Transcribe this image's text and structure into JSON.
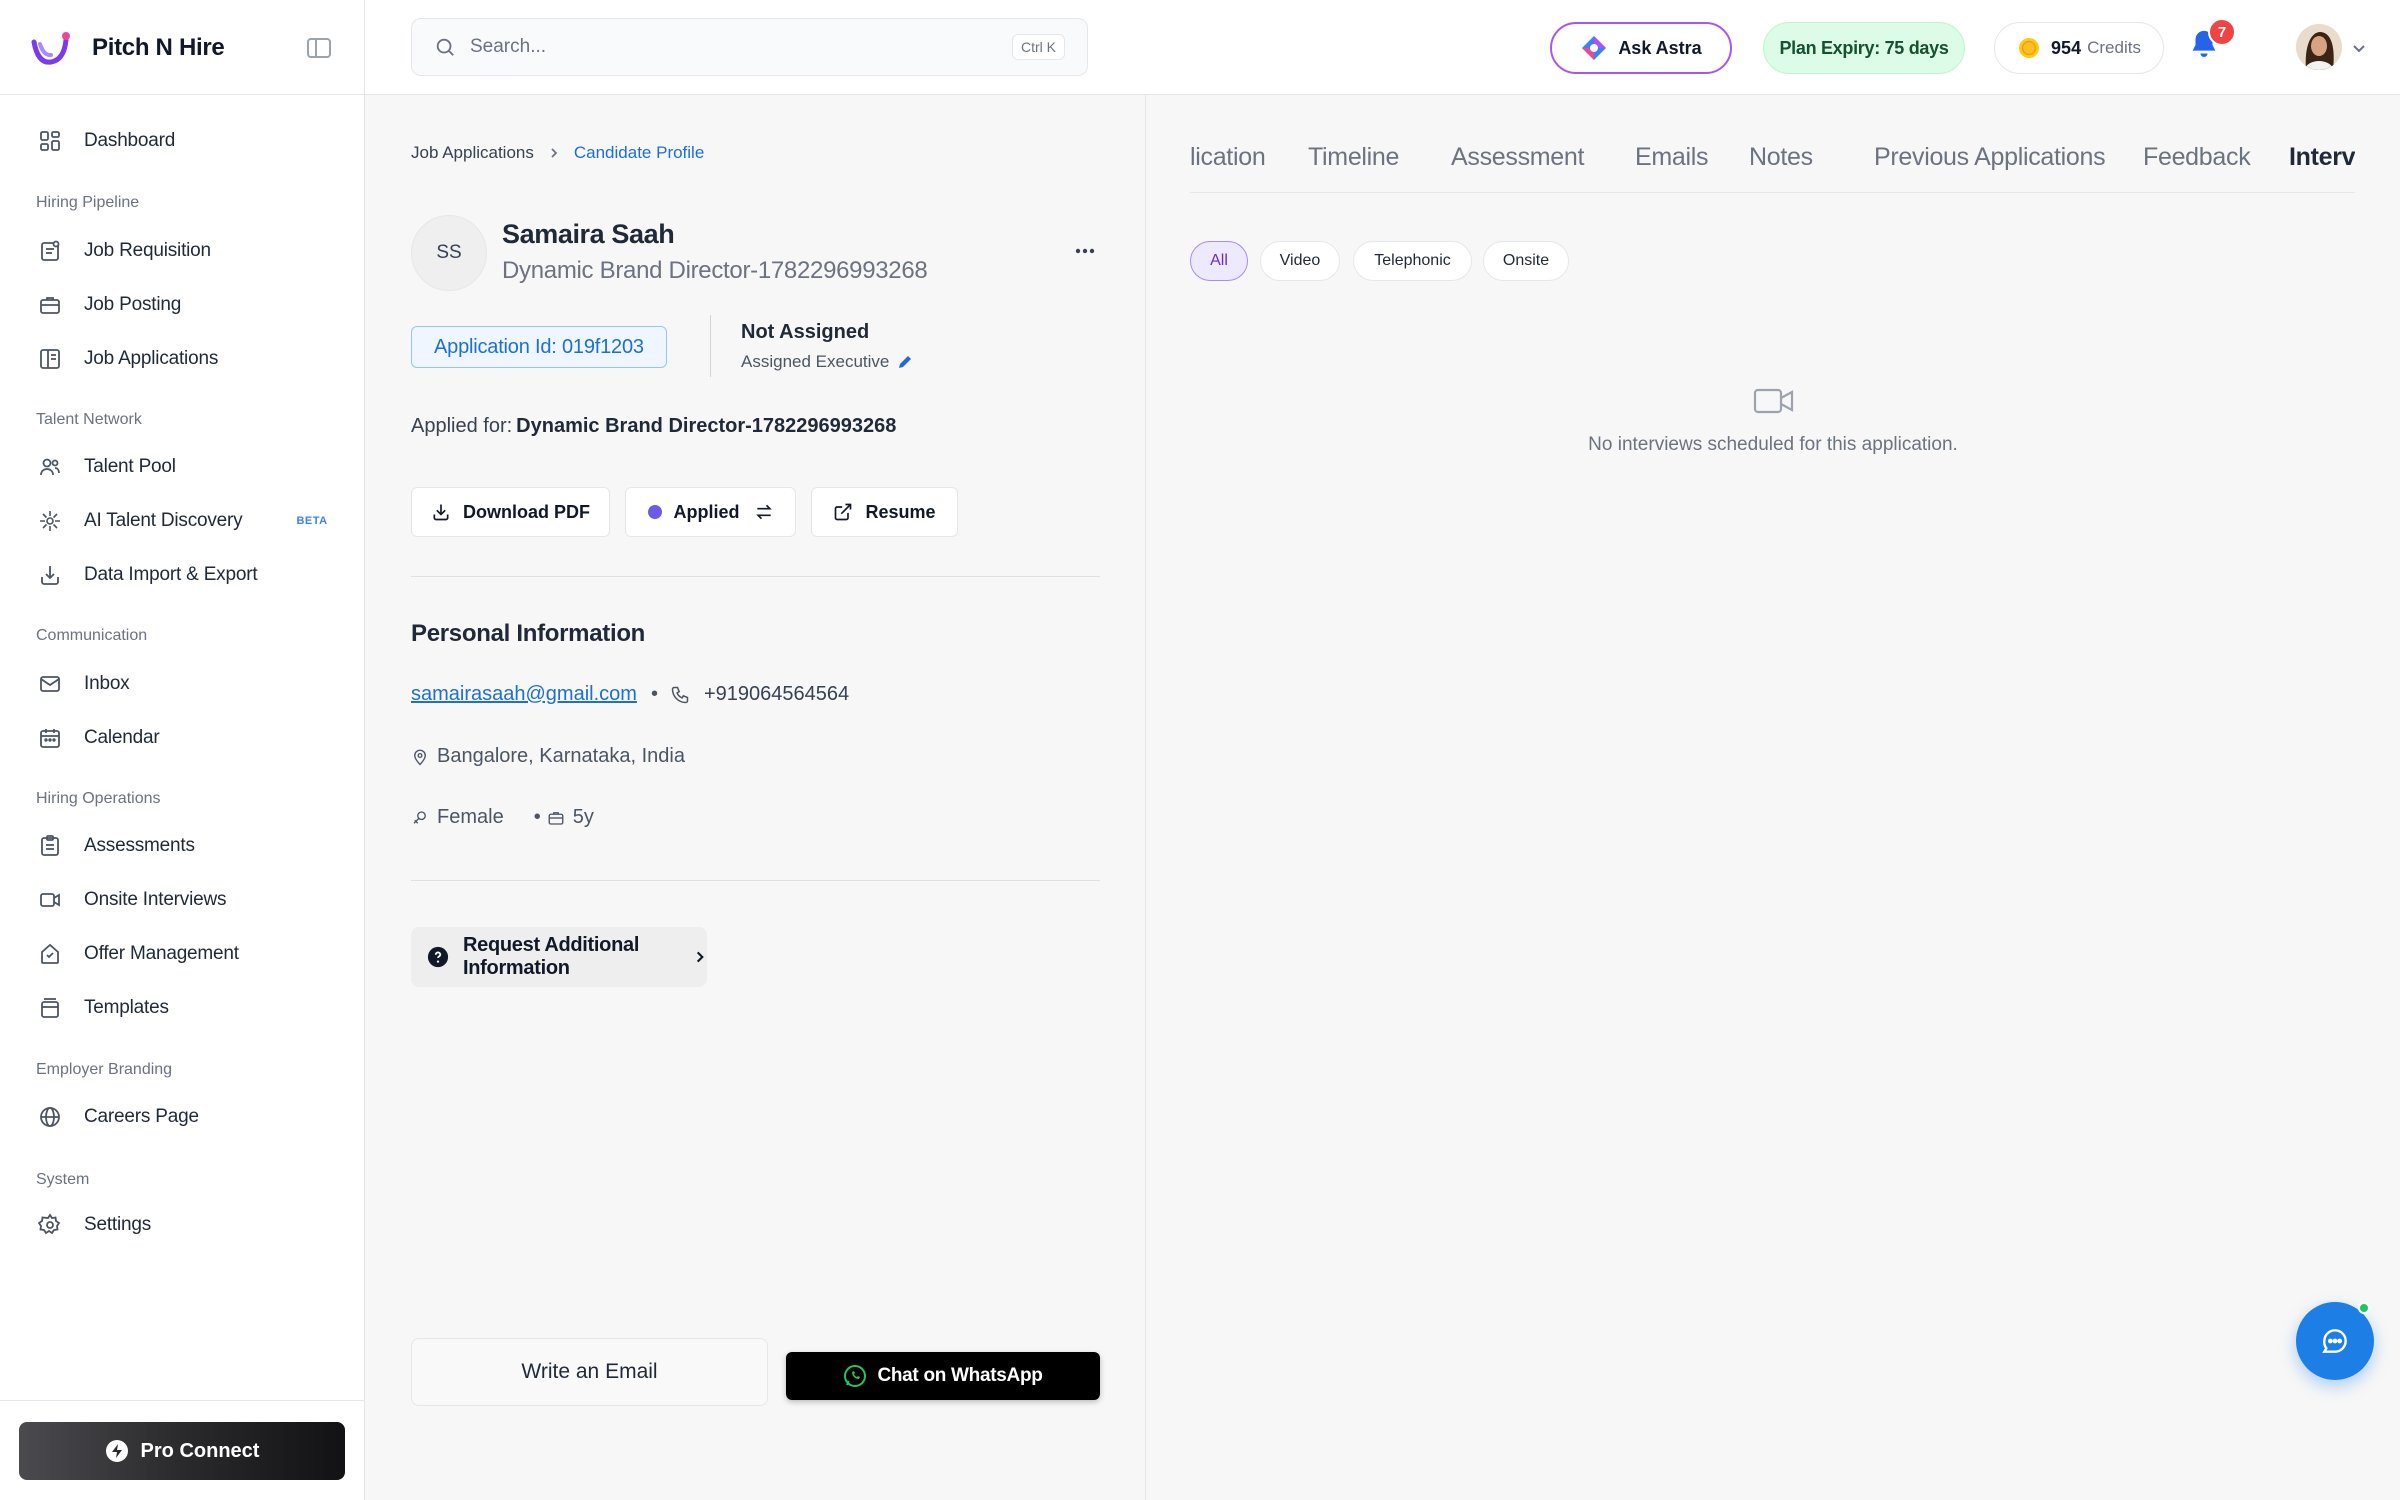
{
  "brand": {
    "name": "Pitch N Hire"
  },
  "sidebar": {
    "items": [
      {
        "label": "Dashboard",
        "icon": "dashboard-grid-icon"
      },
      {
        "section": "Hiring Pipeline"
      },
      {
        "label": "Job Requisition",
        "icon": "clipboard-icon"
      },
      {
        "label": "Job Posting",
        "icon": "briefcase-icon"
      },
      {
        "label": "Job Applications",
        "icon": "applications-icon"
      },
      {
        "section": "Talent Network"
      },
      {
        "label": "Talent Pool",
        "icon": "users-icon"
      },
      {
        "label": "AI Talent Discovery",
        "icon": "ai-spark-icon",
        "badge": "BETA"
      },
      {
        "label": "Data Import & Export",
        "icon": "import-icon"
      },
      {
        "section": "Communication"
      },
      {
        "label": "Inbox",
        "icon": "mail-icon"
      },
      {
        "label": "Calendar",
        "icon": "calendar-icon"
      },
      {
        "section": "Hiring Operations"
      },
      {
        "label": "Assessments",
        "icon": "assessment-icon"
      },
      {
        "label": "Onsite Interviews",
        "icon": "video-icon"
      },
      {
        "label": "Offer Management",
        "icon": "offer-icon"
      },
      {
        "label": "Templates",
        "icon": "templates-icon"
      },
      {
        "section": "Employer Branding"
      },
      {
        "label": "Careers Page",
        "icon": "globe-icon"
      },
      {
        "section": "System"
      },
      {
        "label": "Settings",
        "icon": "gear-icon"
      }
    ],
    "pro_connect": "Pro Connect"
  },
  "topbar": {
    "search_placeholder": "Search...",
    "search_shortcut": "Ctrl K",
    "ask_astra": "Ask Astra",
    "plan_expiry": "Plan Expiry: 75 days",
    "credits_value": "954",
    "credits_unit": "Credits",
    "notifications_count": "7"
  },
  "breadcrumb": {
    "parent": "Job Applications",
    "current": "Candidate Profile"
  },
  "candidate": {
    "initials": "SS",
    "name": "Samaira Saah",
    "role": "Dynamic Brand Director-1782296993268",
    "application_id": "Application Id: 019f1203",
    "assignee": "Not Assigned",
    "assignee_label": "Assigned Executive",
    "applied_for_label": "Applied for:",
    "applied_for_value": "Dynamic Brand Director-1782296993268",
    "email": "samairasaah@gmail.com",
    "phone": "+919064564564",
    "location": "Bangalore, Karnataka, India",
    "gender": "Female",
    "experience": "5y"
  },
  "actions": {
    "download_pdf": "Download PDF",
    "status": "Applied",
    "resume": "Resume",
    "request_info": "Request Additional Information",
    "write_email": "Write an Email",
    "whatsapp": "Chat on WhatsApp"
  },
  "personal_info_title": "Personal Information",
  "tabs": [
    "lication",
    "Timeline",
    "Assessment",
    "Emails",
    "Notes",
    "Previous Applications",
    "Feedback",
    "Interviews"
  ],
  "active_tab": "Interviews",
  "filters": [
    "All",
    "Video",
    "Telephonic",
    "Onsite"
  ],
  "active_filter": "All",
  "empty_state": "No interviews scheduled for this application.",
  "colors": {
    "accent_blue": "#1d6fd6",
    "status_dot": "#6d5ae6",
    "plan_bg": "#dcfce7",
    "badge_red": "#ef4444",
    "fab_blue": "#1d7fe6"
  }
}
